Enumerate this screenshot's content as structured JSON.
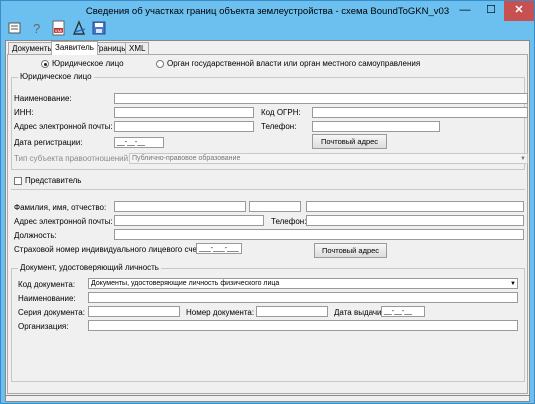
{
  "window": {
    "title": "Сведения об участках границ объекта землеустройства - схема BoundToGKN_v03",
    "minimize": "—",
    "maximize": "☐",
    "close": "✕"
  },
  "toolbar": [
    {
      "name": "open-icon"
    },
    {
      "name": "help-icon"
    },
    {
      "name": "xml-icon"
    },
    {
      "name": "sign-icon"
    },
    {
      "name": "save-icon"
    }
  ],
  "tabs": [
    "Документы",
    "Заявитель",
    "Границы",
    "XML"
  ],
  "applicant_type": {
    "option_legal": "Юридическое лицо",
    "option_authority": "Орган государственной власти или орган местного самоуправления"
  },
  "legal_entity": {
    "group_title": "Юридическое лицо",
    "name_label": "Наименование:",
    "name_value": "",
    "inn_label": "ИНН:",
    "inn_value": "",
    "ogrn_label": "Код ОГРН:",
    "ogrn_value": "",
    "email_label": "Адрес электронной почты:",
    "email_value": "",
    "phone_label": "Телефон:",
    "phone_value": "",
    "reg_date_label": "Дата регистрации:",
    "reg_date_value": "__-__-__",
    "postal_button": "Почтовый адрес",
    "subject_type_label": "Тип субъекта правоотношений:",
    "subject_type_value": "Публично-правовое образование"
  },
  "representative": {
    "checkbox_label": "Представитель",
    "fio_label": "Фамилия, имя, отчество:",
    "email_label": "Адрес электронной почты:",
    "phone_label": "Телефон:",
    "position_label": "Должность:",
    "snils_label": "Страховой номер индивидуального лицевого счета :",
    "snils_value": "___-___-___",
    "postal_button": "Почтовый адрес"
  },
  "identity_doc": {
    "group_title": "Документ, удостоверяющий личность",
    "code_label": "Код документа:",
    "code_value": "Документы, удостоверяющие личность физического лица",
    "name_label": "Наименование:",
    "series_label": "Серия документа:",
    "number_label": "Номер документа:",
    "issue_date_label": "Дата выдачи:",
    "issue_date_value": "__-__-__",
    "org_label": "Организация:"
  }
}
